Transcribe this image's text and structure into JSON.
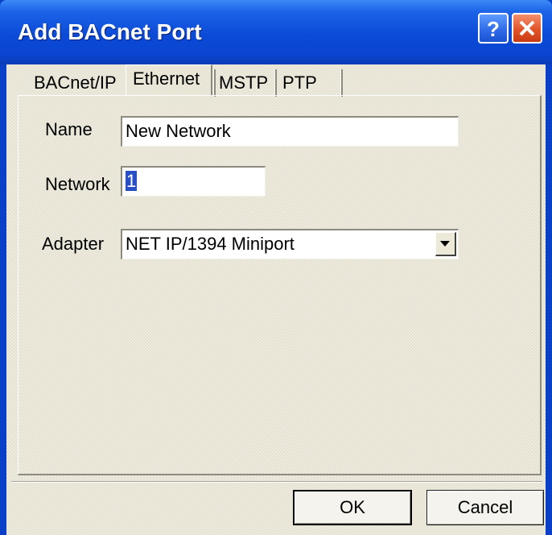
{
  "window": {
    "title": "Add BACnet Port"
  },
  "tabs": [
    {
      "label": "BACnet/IP"
    },
    {
      "label": "Ethernet",
      "selected": true
    },
    {
      "label": "MSTP"
    },
    {
      "label": "PTP"
    }
  ],
  "form": {
    "name_label": "Name",
    "name_value": "New Network",
    "network_label": "Network",
    "network_value": "1",
    "adapter_label": "Adapter",
    "adapter_value": "NET IP/1394 Miniport"
  },
  "buttons": {
    "ok_label": "OK",
    "cancel_label": "Cancel"
  },
  "colors": {
    "titlebar": "#0b4ad7",
    "client_bg": "#e6e2d2",
    "selection": "#2a4fc4",
    "close_button": "#e2542a",
    "help_button": "#2d69e8"
  },
  "icons": {
    "help": "help-icon",
    "close": "close-icon",
    "dropdown": "chevron-down-icon"
  }
}
